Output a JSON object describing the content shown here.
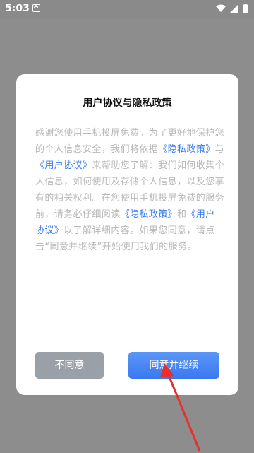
{
  "status_bar": {
    "time": "5:03"
  },
  "dialog": {
    "title": "用户协议与隐私政策",
    "body": {
      "p1": "感谢您使用手机投屏免费。为了更好地保护您的个人信息安全，我们将依据",
      "privacy_link_1": "《隐私政策》",
      "p2": "与",
      "user_link_1": "《用户协议》",
      "p3": "来帮助您了解：我们如何收集个人信息，如何使用及存储个人信息，以及您享有的相关权利。在您使用手机投屏免费的服务前，请务必仔细阅读",
      "privacy_link_2": "《隐私政策》",
      "p4": "和",
      "user_link_2": "《用户协议》",
      "p5": "以了解详细内容。如果您同意，请点击“同意并继续”开始使用我们的服务。"
    },
    "decline_label": "不同意",
    "agree_label": "同意并继续"
  },
  "colors": {
    "accent": "#3a7bf1",
    "arrow": "#e4322b"
  }
}
